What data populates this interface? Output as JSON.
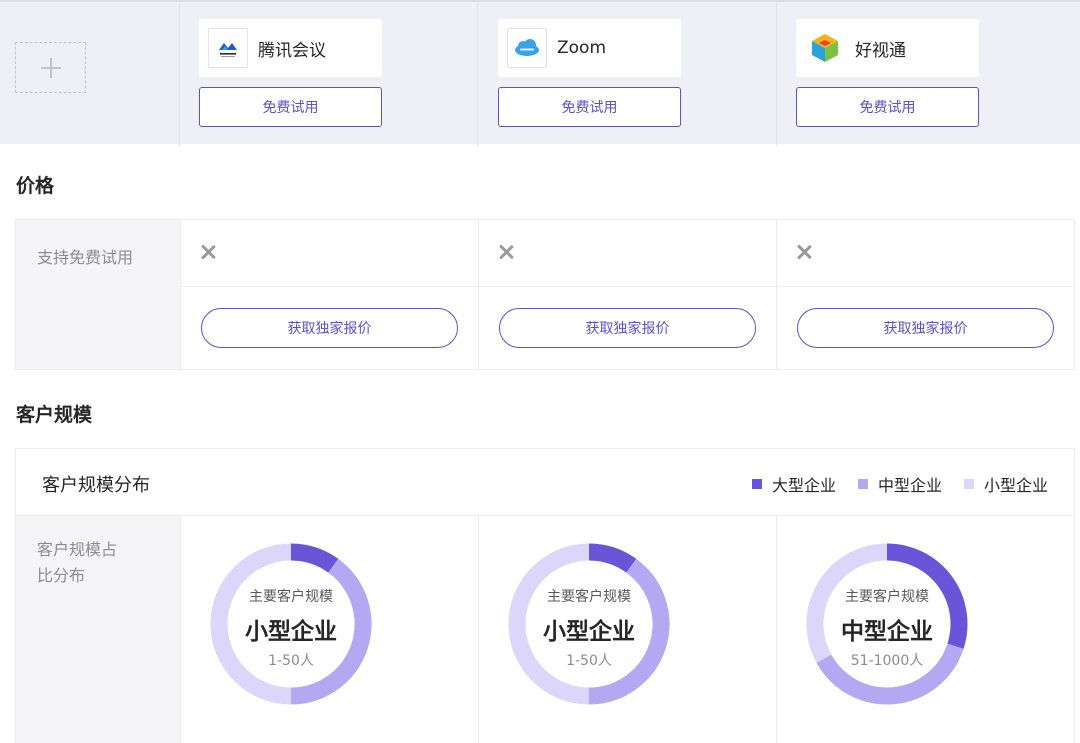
{
  "colors": {
    "accent": "#5b4fd3",
    "large": "#6a55d8",
    "medium": "#b4a8f2",
    "small": "#dcd6fa"
  },
  "header": {
    "add_icon": "plus-icon",
    "products": [
      {
        "name": "腾讯会议",
        "logo": "tencent-meeting-logo",
        "trial_label": "免费试用"
      },
      {
        "name": "Zoom",
        "logo": "zoom-logo",
        "trial_label": "免费试用"
      },
      {
        "name": "好视通",
        "logo": "haoshitong-logo",
        "trial_label": "免费试用"
      }
    ]
  },
  "price": {
    "title": "价格",
    "free_trial_label": "支持免费试用",
    "free_trial_values": [
      "close-icon",
      "close-icon",
      "close-icon"
    ],
    "quote_label": "获取独家报价"
  },
  "scale": {
    "section_title": "客户规模",
    "chart_title": "客户规模分布",
    "row_label": "客户规模占比分布",
    "legend": [
      {
        "label": "大型企业",
        "color": "#6a55d8"
      },
      {
        "label": "中型企业",
        "color": "#b4a8f2"
      },
      {
        "label": "小型企业",
        "color": "#dcd6fa"
      }
    ]
  },
  "chart_data": [
    {
      "type": "pie",
      "categories": [
        "大型企业",
        "中型企业",
        "小型企业"
      ],
      "values": [
        10,
        40,
        50
      ],
      "center_caption": "主要客户规模",
      "center_main": "小型企业",
      "center_range": "1-50人"
    },
    {
      "type": "pie",
      "categories": [
        "大型企业",
        "中型企业",
        "小型企业"
      ],
      "values": [
        10,
        40,
        50
      ],
      "center_caption": "主要客户规模",
      "center_main": "小型企业",
      "center_range": "1-50人"
    },
    {
      "type": "pie",
      "categories": [
        "大型企业",
        "中型企业",
        "小型企业"
      ],
      "values": [
        30,
        37,
        33
      ],
      "center_caption": "主要客户规模",
      "center_main": "中型企业",
      "center_range": "51-1000人"
    }
  ]
}
